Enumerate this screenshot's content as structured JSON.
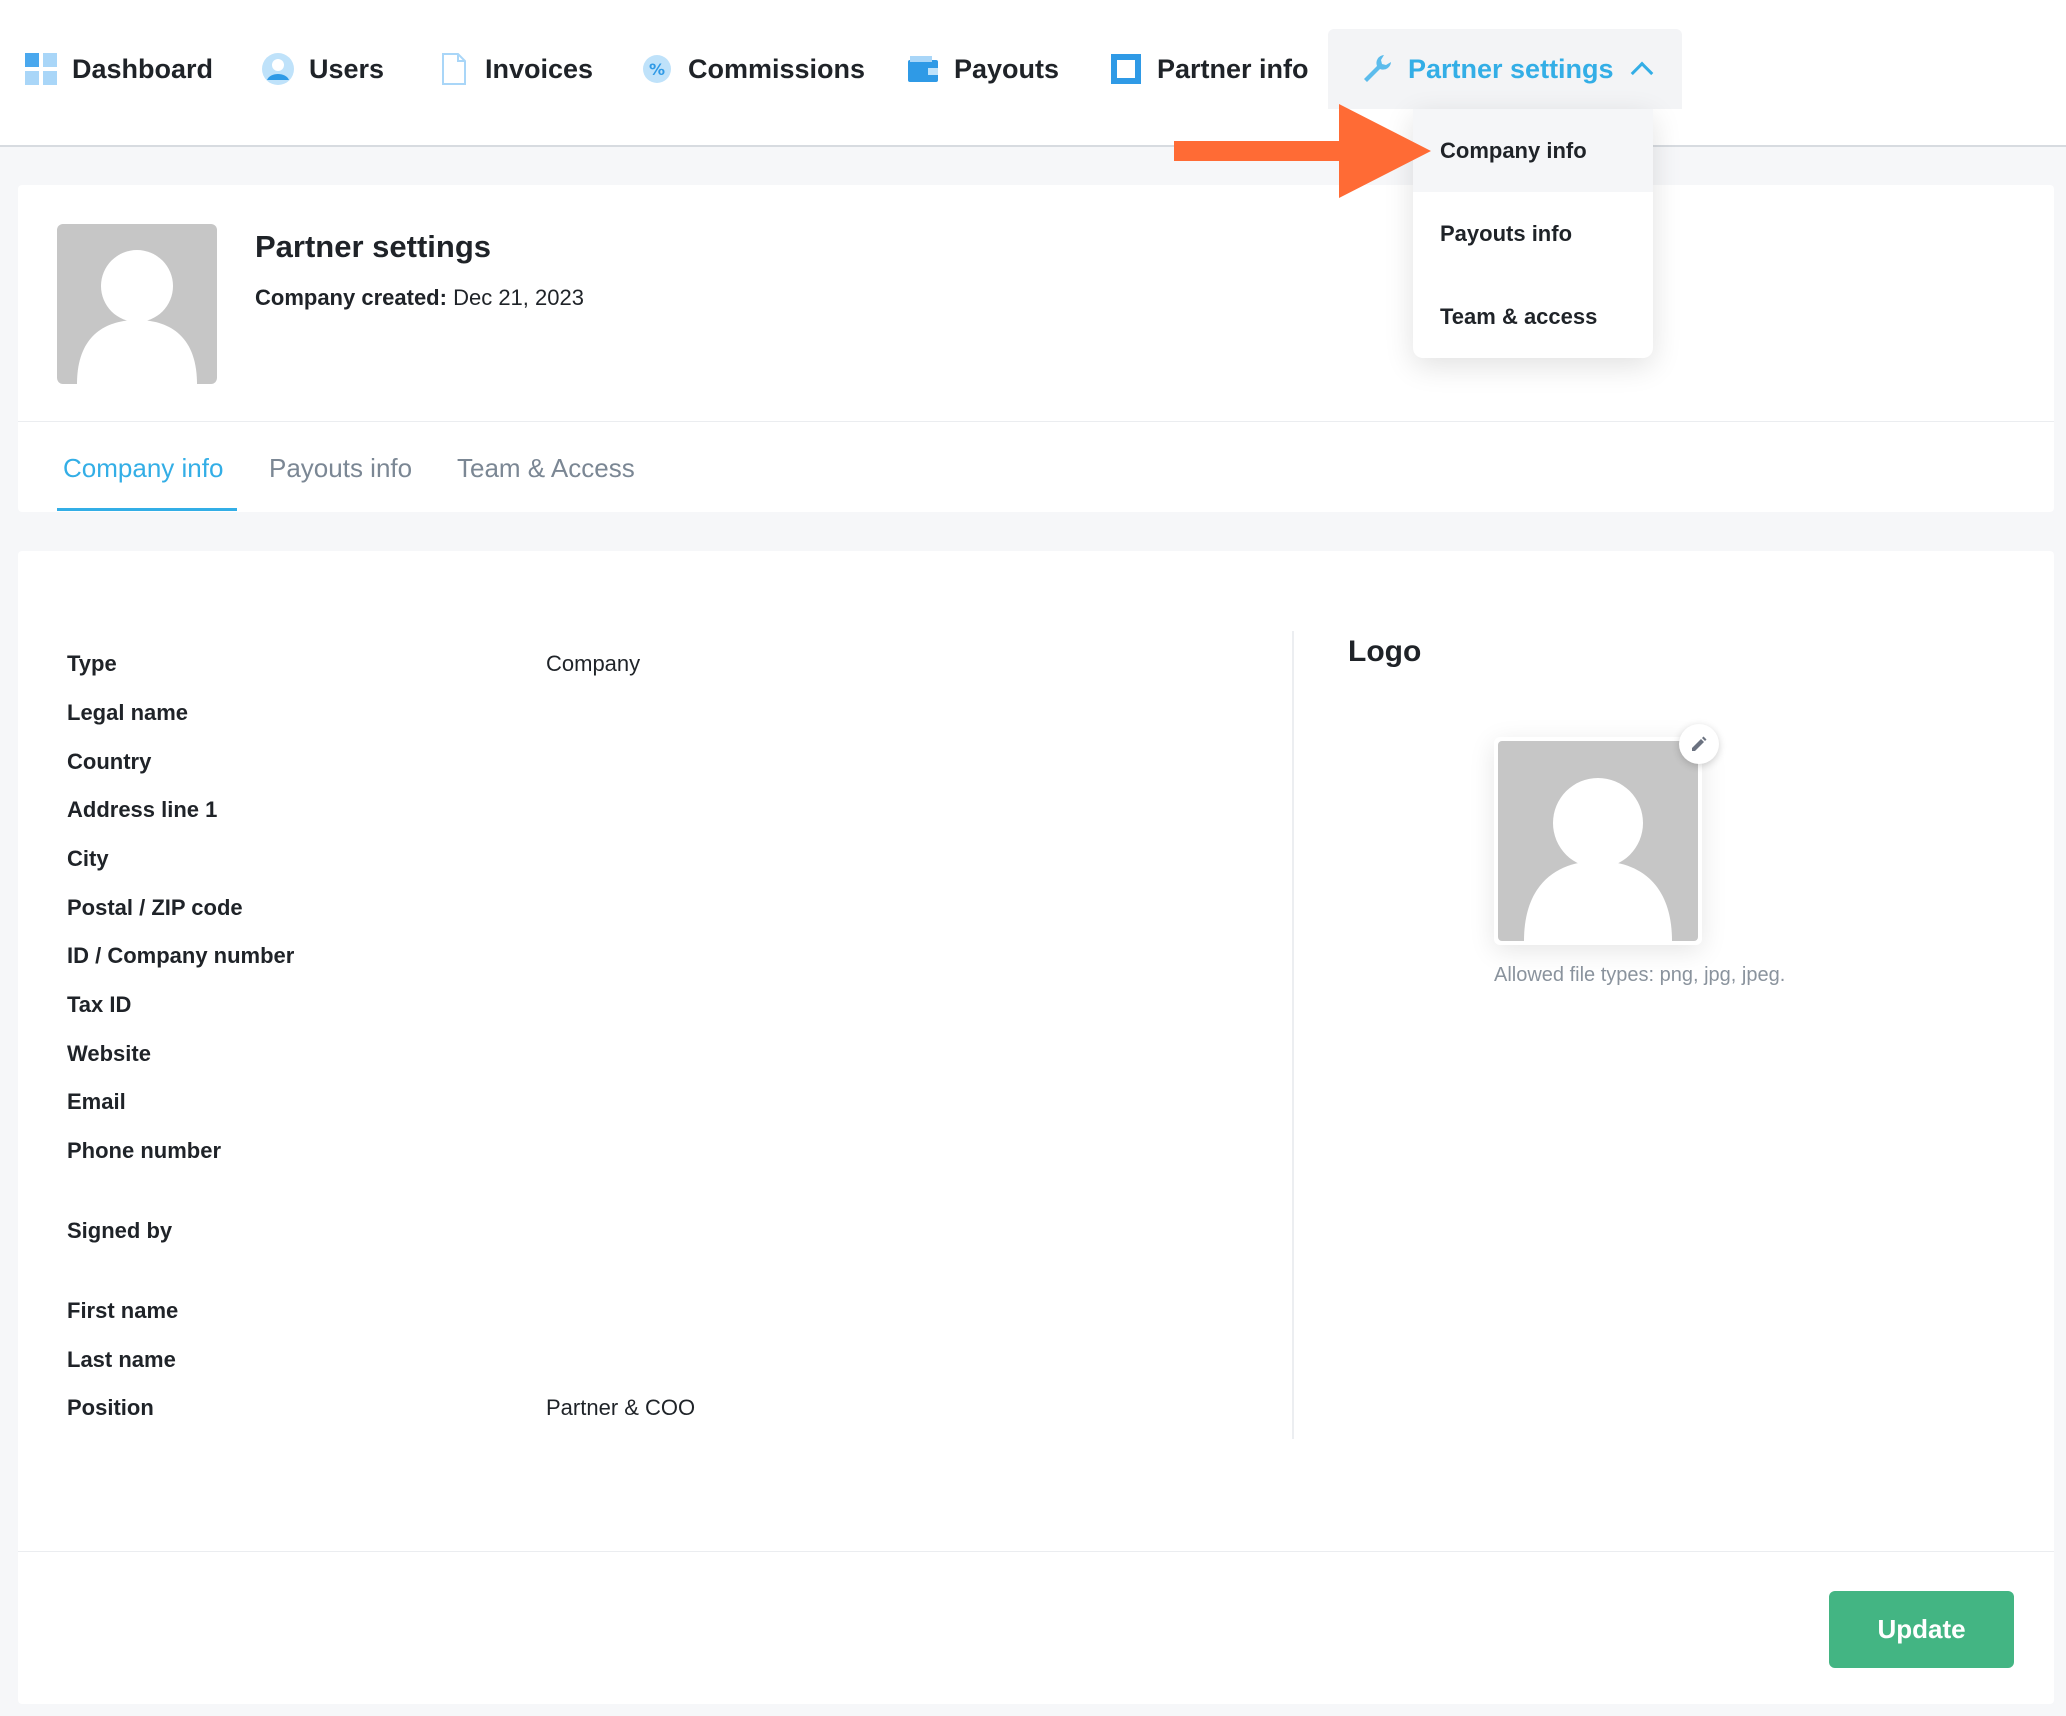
{
  "nav": {
    "items": [
      {
        "label": "Dashboard",
        "icon": "dashboard-icon"
      },
      {
        "label": "Users",
        "icon": "user-icon"
      },
      {
        "label": "Invoices",
        "icon": "document-icon"
      },
      {
        "label": "Commissions",
        "icon": "percent-badge-icon"
      },
      {
        "label": "Payouts",
        "icon": "wallet-icon"
      },
      {
        "label": "Partner info",
        "icon": "square-icon"
      },
      {
        "label": "Partner settings",
        "icon": "wrench-icon",
        "active": true
      }
    ]
  },
  "dropdown": {
    "items": [
      "Company info",
      "Payouts info",
      "Team & access"
    ]
  },
  "header": {
    "title": "Partner settings",
    "created_label": "Company created:",
    "created_value": "Dec 21, 2023"
  },
  "tabs": [
    "Company info",
    "Payouts info",
    "Team & Access"
  ],
  "form": {
    "fields": [
      {
        "label": "Type",
        "value": "Company"
      },
      {
        "label": "Legal name",
        "value": ""
      },
      {
        "label": "Country",
        "value": ""
      },
      {
        "label": "Address line 1",
        "value": ""
      },
      {
        "label": "City",
        "value": ""
      },
      {
        "label": "Postal / ZIP code",
        "value": ""
      },
      {
        "label": "ID / Company number",
        "value": ""
      },
      {
        "label": "Tax ID",
        "value": ""
      },
      {
        "label": "Website",
        "value": ""
      },
      {
        "label": "Email",
        "value": ""
      },
      {
        "label": "Phone number",
        "value": ""
      }
    ],
    "signed_by_label": "Signed by",
    "signer_fields": [
      {
        "label": "First name",
        "value": ""
      },
      {
        "label": "Last name",
        "value": ""
      },
      {
        "label": "Position",
        "value": "Partner & COO"
      }
    ]
  },
  "logo": {
    "title": "Logo",
    "allowed_text": "Allowed file types: png, jpg, jpeg."
  },
  "actions": {
    "update_label": "Update"
  },
  "colors": {
    "accent": "#33aee6",
    "arrow": "#ff6b35",
    "update": "#43b583"
  }
}
